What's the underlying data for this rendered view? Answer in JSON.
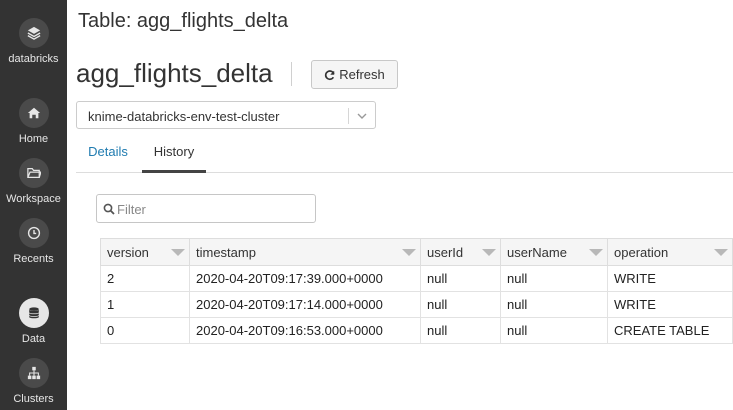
{
  "sidebar": {
    "logo_label": "databricks",
    "items": [
      {
        "label": "Home",
        "icon": "home-icon"
      },
      {
        "label": "Workspace",
        "icon": "folder-icon"
      },
      {
        "label": "Recents",
        "icon": "clock-icon"
      },
      {
        "label": "Data",
        "icon": "database-icon",
        "active": true
      },
      {
        "label": "Clusters",
        "icon": "clusters-icon"
      }
    ]
  },
  "header": {
    "page_title": "Table: agg_flights_delta",
    "table_name": "agg_flights_delta",
    "refresh_label": "Refresh"
  },
  "cluster_select": {
    "value": "knime-databricks-env-test-cluster"
  },
  "tabs": [
    {
      "label": "Details",
      "active": false
    },
    {
      "label": "History",
      "active": true
    }
  ],
  "filter": {
    "placeholder": "Filter"
  },
  "history_table": {
    "columns": [
      "version",
      "timestamp",
      "userId",
      "userName",
      "operation"
    ],
    "rows": [
      [
        "2",
        "2020-04-20T09:17:39.000+0000",
        "null",
        "null",
        "WRITE"
      ],
      [
        "1",
        "2020-04-20T09:17:14.000+0000",
        "null",
        "null",
        "WRITE"
      ],
      [
        "0",
        "2020-04-20T09:16:53.000+0000",
        "null",
        "null",
        "CREATE TABLE"
      ]
    ]
  },
  "colors": {
    "sidebar_bg": "#333333",
    "tab_link": "#1f7bb0"
  }
}
